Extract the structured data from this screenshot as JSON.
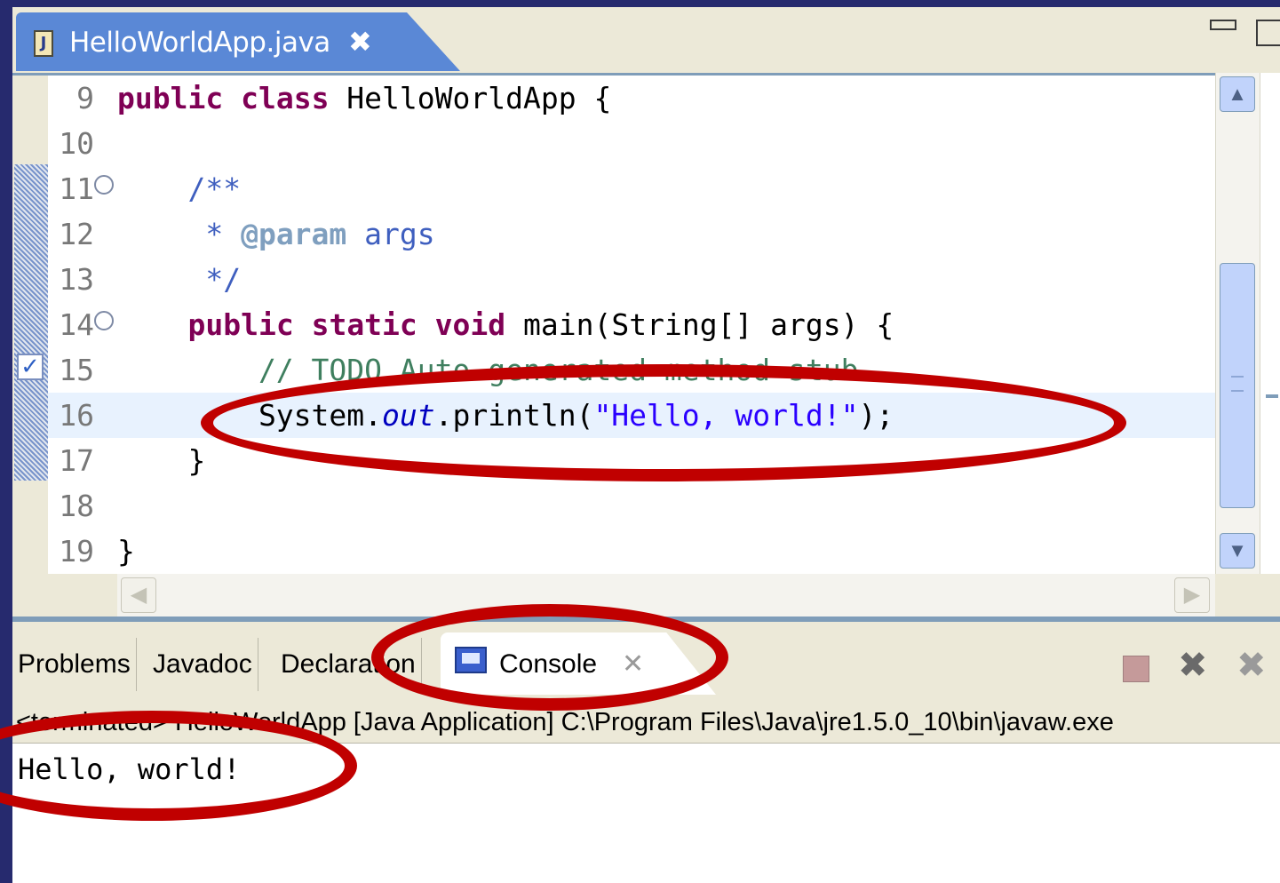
{
  "editor": {
    "tab_title": "HelloWorldApp.java",
    "tab_close": "✖",
    "file_icon": "J",
    "lines": [
      {
        "num": "9",
        "segments": [
          {
            "cls": "kw",
            "text": "public"
          },
          {
            "cls": "",
            "text": " "
          },
          {
            "cls": "kw",
            "text": "class"
          },
          {
            "cls": "",
            "text": " HelloWorldApp {"
          }
        ]
      },
      {
        "num": "10",
        "segments": []
      },
      {
        "num": "11",
        "fold": "⊖",
        "segments": [
          {
            "cls": "jd",
            "text": "    /**"
          }
        ]
      },
      {
        "num": "12",
        "segments": [
          {
            "cls": "jd",
            "text": "     * "
          },
          {
            "cls": "jdtag",
            "text": "@param"
          },
          {
            "cls": "jd",
            "text": " args"
          }
        ]
      },
      {
        "num": "13",
        "segments": [
          {
            "cls": "jd",
            "text": "     */"
          }
        ]
      },
      {
        "num": "14",
        "fold": "⊖",
        "segments": [
          {
            "cls": "",
            "text": "    "
          },
          {
            "cls": "kw",
            "text": "public"
          },
          {
            "cls": "",
            "text": " "
          },
          {
            "cls": "kw",
            "text": "static"
          },
          {
            "cls": "",
            "text": " "
          },
          {
            "cls": "kw",
            "text": "void"
          },
          {
            "cls": "",
            "text": " main(String[] args) {"
          }
        ]
      },
      {
        "num": "15",
        "segments": [
          {
            "cls": "cm",
            "text": "        // TODO Auto-generated method stub"
          }
        ]
      },
      {
        "num": "16",
        "current": true,
        "segments": [
          {
            "cls": "",
            "text": "        System."
          },
          {
            "cls": "fld",
            "text": "out"
          },
          {
            "cls": "",
            "text": ".println("
          },
          {
            "cls": "str",
            "text": "\"Hello, world!\""
          },
          {
            "cls": "",
            "text": ");"
          }
        ]
      },
      {
        "num": "17",
        "segments": [
          {
            "cls": "",
            "text": "    }"
          }
        ]
      },
      {
        "num": "18",
        "segments": []
      },
      {
        "num": "19",
        "segments": [
          {
            "cls": "",
            "text": "}"
          }
        ]
      }
    ],
    "task_marker": "✓",
    "scroll_up": "▲",
    "scroll_down": "▼",
    "scroll_left": "◀",
    "scroll_right": "▶"
  },
  "panel": {
    "tabs": [
      "Problems",
      "Javadoc",
      "Declaration"
    ],
    "active_tab": "Console",
    "active_tab_close": "✕",
    "toolbar": {
      "remove_launch": "✖",
      "remove_all": "✖"
    },
    "console_header": "<terminated> HelloWorldApp [Java Application] C:\\Program Files\\Java\\jre1.5.0_10\\bin\\javaw.exe",
    "console_output": "Hello, world!"
  },
  "colors": {
    "accent_red": "#c00000",
    "frame": "#262a6e",
    "keyword": "#7f0055",
    "string": "#2a00ff",
    "comment": "#3f7f5f"
  }
}
